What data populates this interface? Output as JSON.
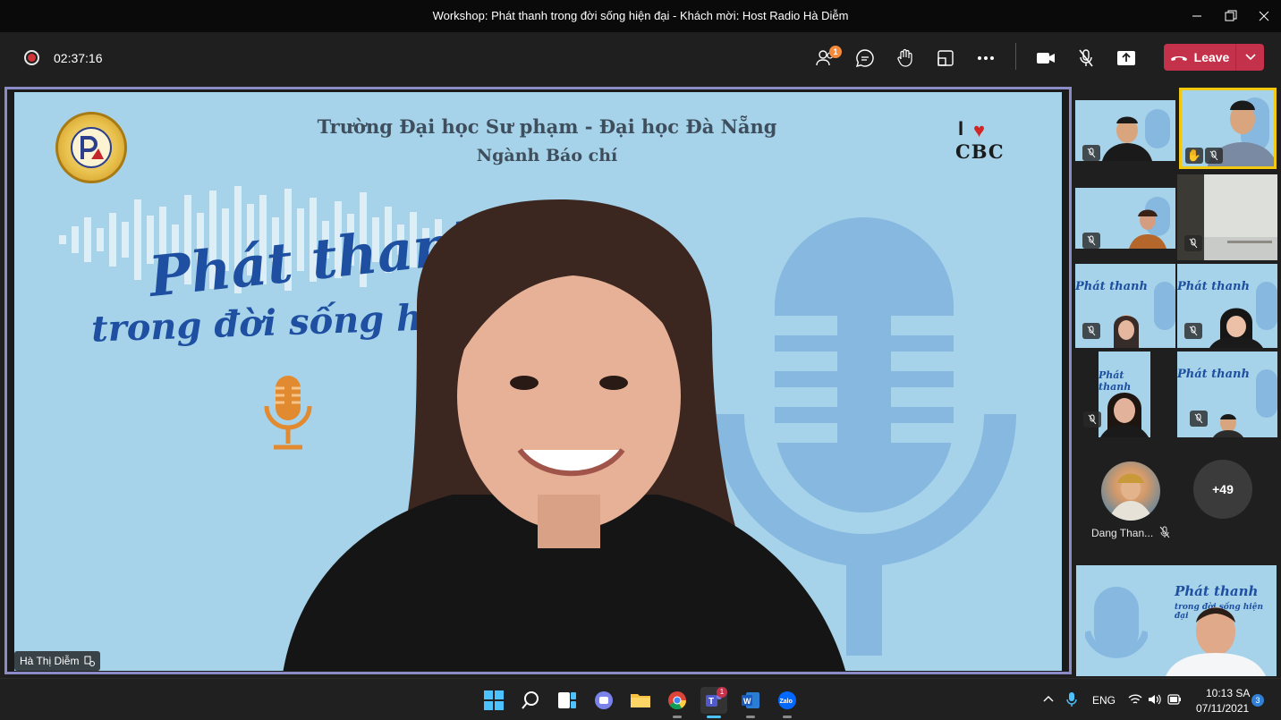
{
  "window": {
    "title": "Workshop: Phát thanh trong đời sống hiện đại - Khách mời: Host Radio Hà Diễm"
  },
  "toolbar": {
    "timer": "02:37:16",
    "participants_badge": "1",
    "leave_label": "Leave",
    "accent_color": "#c4314b"
  },
  "main_video": {
    "speaker_name": "Hà Thị Diễm",
    "background": {
      "line1": "Trường Đại học Sư phạm - Đại học Đà Nẵng",
      "line2": "Ngành Báo chí",
      "headline1": "Phát thanh",
      "headline2": "trong đời sống hiện",
      "brand_i": "I",
      "brand_cbc": "CBC"
    }
  },
  "gallery": {
    "avatar_name": "Dang Than...",
    "overflow_count": "+49"
  },
  "taskbar": {
    "teams_badge": "1",
    "language": "ENG",
    "time": "10:13 SA",
    "date": "07/11/2021",
    "notification_count": "3"
  }
}
